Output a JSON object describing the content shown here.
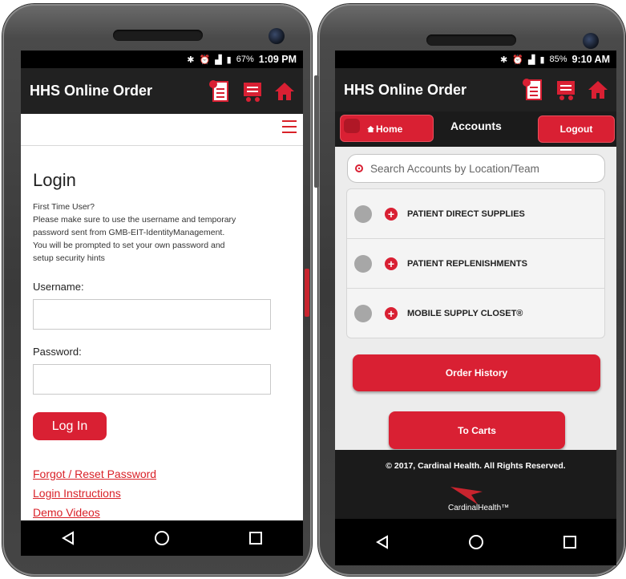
{
  "left_phone": {
    "status": {
      "battery": "67%",
      "time": "1:09 PM"
    },
    "app_title": "HHS Online Order",
    "login": {
      "title": "Login",
      "note_lines": [
        "First Time User?",
        "Please make sure to use the username and temporary",
        "password sent from GMB-EIT-IdentityManagement.",
        "You will be prompted to set your own password and",
        "setup security hints"
      ],
      "username_label": "Username:",
      "username_value": "",
      "password_label": "Password:",
      "password_value": "",
      "button": "Log In",
      "links": [
        "Forgot / Reset Password",
        "Login Instructions",
        "Demo Videos"
      ]
    }
  },
  "right_phone": {
    "status": {
      "battery": "85%",
      "time": "9:10 AM"
    },
    "app_title": "HHS Online Order",
    "home_button": "Home",
    "page_title": "Accounts",
    "logout_button": "Logout",
    "search_placeholder": "Search Accounts by Location/Team",
    "accounts": [
      "PATIENT DIRECT SUPPLIES",
      "PATIENT REPLENISHMENTS",
      "MOBILE SUPPLY CLOSET®"
    ],
    "order_history_button": "Order History",
    "to_carts_button": "To Carts",
    "footer_copyright": "© 2017, Cardinal Health. All Rights Reserved.",
    "footer_logo_text": "CardinalHealth™"
  },
  "colors": {
    "accent": "#d92033",
    "appbar": "#212121",
    "link": "#d92128"
  },
  "icons": [
    "document-icon",
    "cart-icon",
    "home-icon",
    "menu-icon",
    "search-icon",
    "back-icon",
    "home-circle-icon",
    "recents-icon"
  ]
}
